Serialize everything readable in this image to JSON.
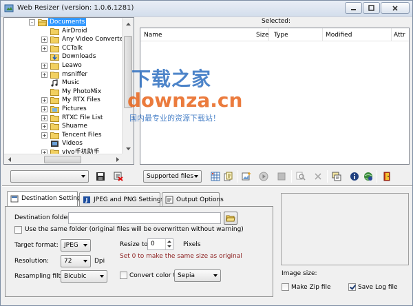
{
  "window": {
    "title": "Web Resizer (version: 1.0.6.1281)"
  },
  "tree": {
    "items": [
      {
        "label": "Documents",
        "indent": 1,
        "expander": "-",
        "selected": true,
        "icon": "folder-open-icon"
      },
      {
        "label": "AirDroid",
        "indent": 2,
        "expander": "",
        "icon": "folder-icon"
      },
      {
        "label": "Any Video Converter Ultir",
        "indent": 2,
        "expander": "+",
        "icon": "folder-icon"
      },
      {
        "label": "CCTalk",
        "indent": 2,
        "expander": "+",
        "icon": "folder-icon"
      },
      {
        "label": "Downloads",
        "indent": 2,
        "expander": "",
        "icon": "downloads-icon"
      },
      {
        "label": "Leawo",
        "indent": 2,
        "expander": "+",
        "icon": "folder-icon"
      },
      {
        "label": "msniffer",
        "indent": 2,
        "expander": "+",
        "icon": "folder-icon"
      },
      {
        "label": "Music",
        "indent": 2,
        "expander": "",
        "icon": "music-icon"
      },
      {
        "label": "My PhotoMix",
        "indent": 2,
        "expander": "",
        "icon": "folder-icon"
      },
      {
        "label": "My RTX Files",
        "indent": 2,
        "expander": "+",
        "icon": "folder-icon"
      },
      {
        "label": "Pictures",
        "indent": 2,
        "expander": "+",
        "icon": "pictures-icon"
      },
      {
        "label": "RTXC File List",
        "indent": 2,
        "expander": "+",
        "icon": "folder-icon"
      },
      {
        "label": "Shuame",
        "indent": 2,
        "expander": "+",
        "icon": "folder-icon"
      },
      {
        "label": "Tencent Files",
        "indent": 2,
        "expander": "+",
        "icon": "folder-icon"
      },
      {
        "label": "Videos",
        "indent": 2,
        "expander": "",
        "icon": "videos-icon"
      },
      {
        "label": "vivo手机助手",
        "indent": 2,
        "expander": "+",
        "icon": "folder-icon"
      }
    ]
  },
  "list": {
    "selected_label": "Selected:",
    "columns": [
      "Name",
      "Size",
      "Type",
      "Modified",
      "Attr"
    ]
  },
  "watermark": {
    "line1": "下载之家",
    "line2": "downza.cn",
    "line3": "国内最专业的资源下载站！"
  },
  "toolbar": {
    "path_dropdown": "",
    "filter_dropdown": "Supported files"
  },
  "tabs": [
    {
      "label": "Destination Settings",
      "active": true
    },
    {
      "label": "JPEG and PNG Settings",
      "active": false
    },
    {
      "label": "Output Options",
      "active": false
    }
  ],
  "dest": {
    "folder_label": "Destination folder:",
    "folder_value": "",
    "same_folder_label": "Use the same folder (original files will be overwritten without warning)",
    "same_folder_checked": false,
    "target_format_label": "Target format:",
    "target_format_value": "JPEG",
    "resolution_label": "Resolution:",
    "resolution_value": "72",
    "resolution_unit": "Dpi",
    "resampling_label": "Resampling filter:",
    "resampling_value": "Bicubic",
    "resize_label": "Resize to:",
    "resize_value": "0",
    "resize_unit": "Pixels",
    "resize_hint": "Set 0 to make the same size as original",
    "convert_color_label": "Convert color to:",
    "convert_color_checked": false,
    "convert_color_value": "Sepia"
  },
  "preview": {
    "image_size_label": "Image size:",
    "make_zip_label": "Make Zip file",
    "make_zip_checked": false,
    "save_log_label": "Save Log file",
    "save_log_checked": true
  }
}
